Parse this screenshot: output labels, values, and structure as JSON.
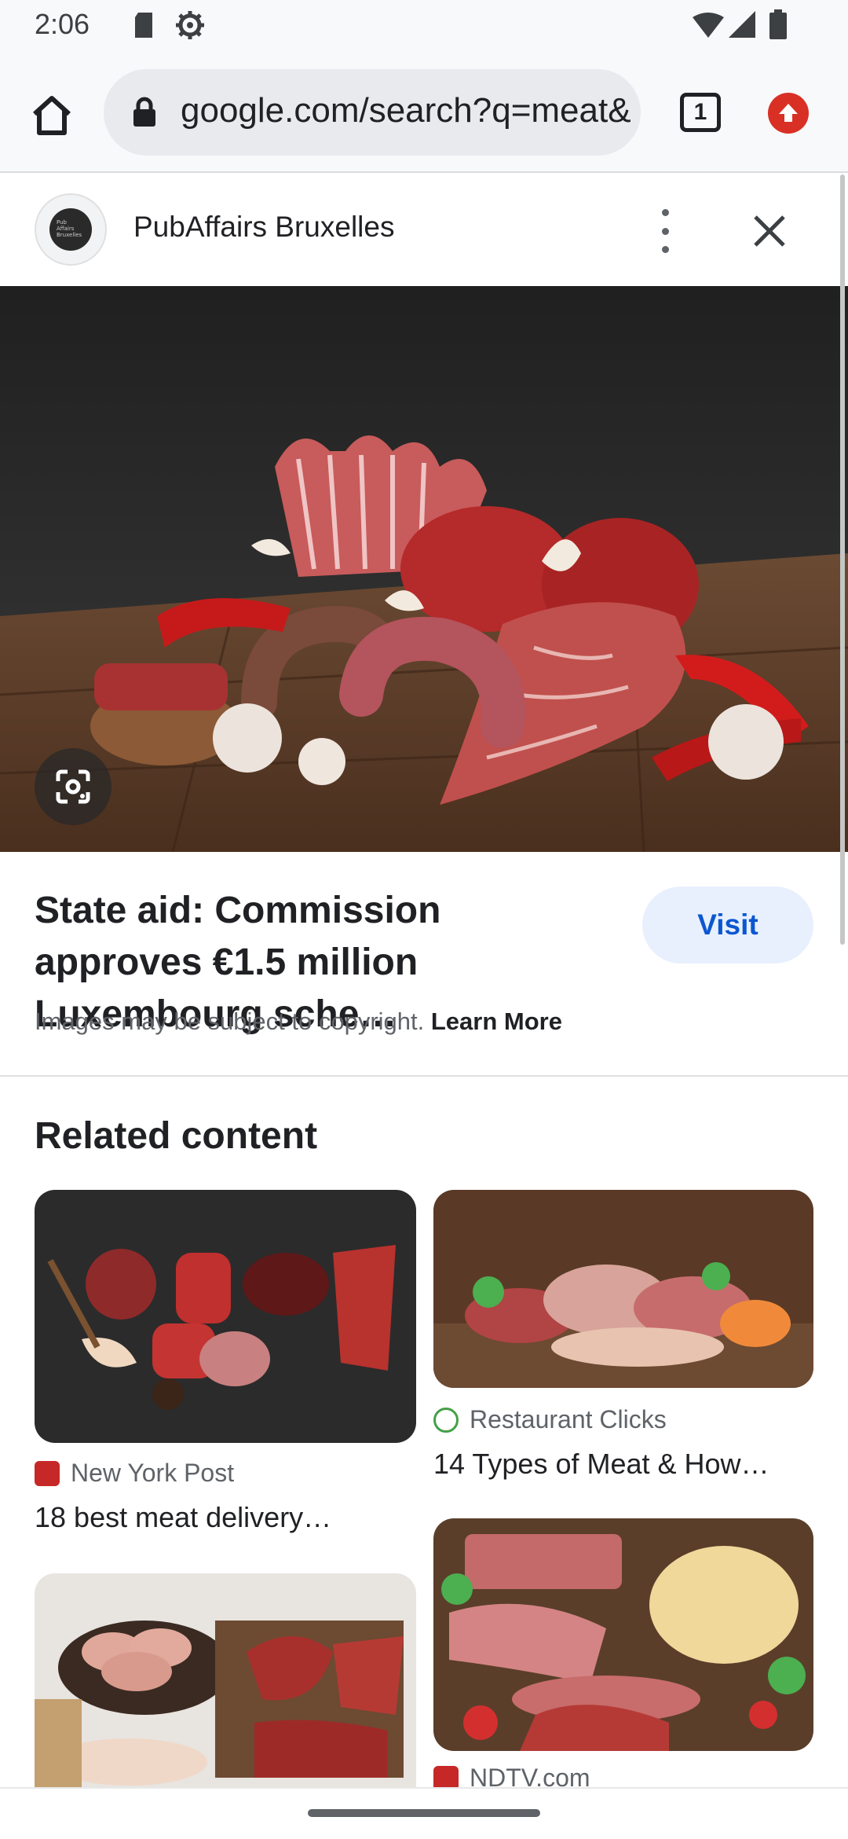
{
  "status_bar": {
    "time": "2:06",
    "icons": [
      "sd-card-icon",
      "settings-gear-icon",
      "wifi-icon",
      "signal-icon",
      "battery-icon"
    ]
  },
  "browser": {
    "url": "google.com/search?q=meat&",
    "tab_count": "1",
    "icons": [
      "home-icon",
      "lock-icon",
      "update-icon"
    ]
  },
  "panel": {
    "source_name": "PubAffairs Bruxelles",
    "logo_text": "Pub Affairs Bruxelles",
    "title": "State aid: Commission approves €1.5 million Luxembourg sche…",
    "visit_label": "Visit",
    "copyright_text": "Images may be subject to copyright.",
    "learn_more": "Learn More"
  },
  "related": {
    "heading": "Related content",
    "cards": [
      {
        "source": "New York Post",
        "title": "18 best meat delivery…",
        "favicon_color": "#c62828"
      },
      {
        "source": "Restaurant Clicks",
        "title": "14 Types of Meat & How…",
        "favicon_color": "#43a047"
      },
      {
        "source": "",
        "title": ""
      },
      {
        "source": "NDTV.com",
        "title": "",
        "favicon_color": "#c62828"
      }
    ]
  },
  "colors": {
    "accent": "#0b57d0",
    "visit_bg": "#e8f0fe",
    "update": "#d93025"
  }
}
